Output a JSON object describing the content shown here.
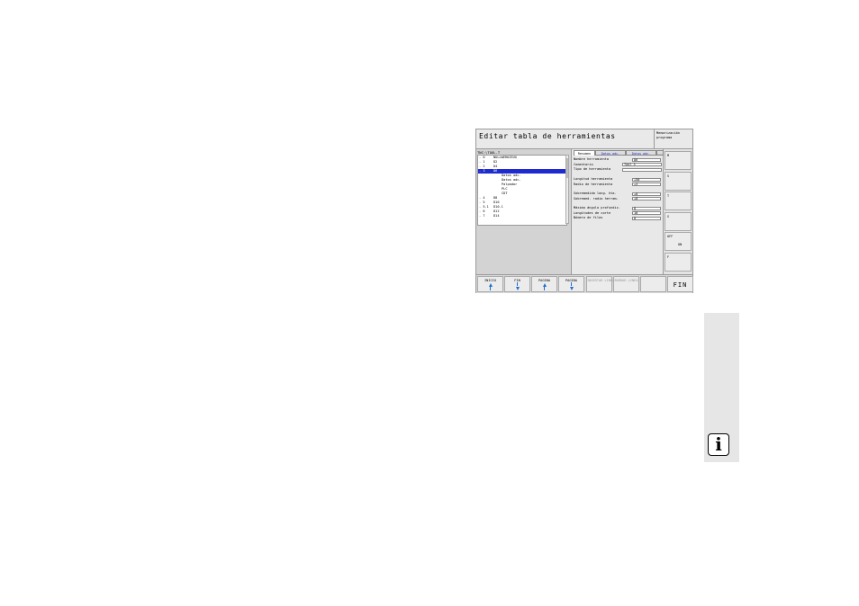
{
  "header": {
    "title": "Editar tabla de herramientas",
    "mode": "Memorización programa"
  },
  "tree": {
    "path": "TNC:\\TOOL.T",
    "rows": [
      {
        "num": "- 0",
        "label": "NULLWERKZEUG"
      },
      {
        "num": "- 1",
        "label": "D2"
      },
      {
        "num": "- 2",
        "label": "D4"
      },
      {
        "num": "- 3",
        "label": "D6"
      },
      {
        "num": "",
        "label": "Datos adc."
      },
      {
        "num": "",
        "label": "Datos adc."
      },
      {
        "num": "",
        "label": "Palpador"
      },
      {
        "num": "",
        "label": "PLC"
      },
      {
        "num": "",
        "label": "CDT"
      },
      {
        "num": "- 4",
        "label": "D8"
      },
      {
        "num": "- 5",
        "label": "D10"
      },
      {
        "num": "- 5.1",
        "label": "D10.1"
      },
      {
        "num": "- 6",
        "label": "D12"
      },
      {
        "num": "- 7",
        "label": "D14"
      }
    ]
  },
  "form": {
    "tabs": [
      "Resumen",
      "Datos adc.",
      "Datos adc.",
      "..."
    ],
    "fields": [
      {
        "label": "Nombre herramienta",
        "value": "D6"
      },
      {
        "label": "Comentario",
        "value": "Tool 3"
      },
      {
        "label": "Tipo de herramienta",
        "value": ""
      },
      {
        "label": "Longitud herramienta",
        "value": "+50"
      },
      {
        "label": "Radio de herramienta",
        "value": "+3"
      },
      {
        "label": "Sobremedida long. hta.",
        "value": "+0"
      },
      {
        "label": "Sobremed. radio herram.",
        "value": "+0"
      },
      {
        "label": "Máximo ángulo profundiz.",
        "value": "0"
      },
      {
        "label": "Longitudes de corte",
        "value": "10"
      },
      {
        "label": "Número de filos",
        "value": "0"
      }
    ]
  },
  "side_keys": [
    {
      "t": "M",
      "t2": ""
    },
    {
      "t": "S",
      "t2": ""
    },
    {
      "t": "T",
      "t2": ""
    },
    {
      "t": "S",
      "t2": ""
    },
    {
      "t": "OFF",
      "t2": "ON"
    },
    {
      "t": "F",
      "t2": ""
    }
  ],
  "bottom_keys": [
    {
      "label": "INICIO",
      "arrow": "up",
      "disabled": false
    },
    {
      "label": "FIN",
      "arrow": "down",
      "disabled": false
    },
    {
      "label": "PAGINA",
      "arrow": "up",
      "disabled": false
    },
    {
      "label": "PAGINA",
      "arrow": "down",
      "disabled": false
    },
    {
      "label": "INSERTAR LINEA",
      "arrow": "",
      "disabled": true
    },
    {
      "label": "BORRAR LINEA",
      "arrow": "",
      "disabled": true
    },
    {
      "label": "",
      "arrow": "",
      "disabled": false
    },
    {
      "label": "FIN",
      "arrow": "",
      "disabled": false
    }
  ],
  "info_icon": "i",
  "colors": {
    "selection": "#1e2bd0",
    "accent": "#1e6fd0"
  }
}
